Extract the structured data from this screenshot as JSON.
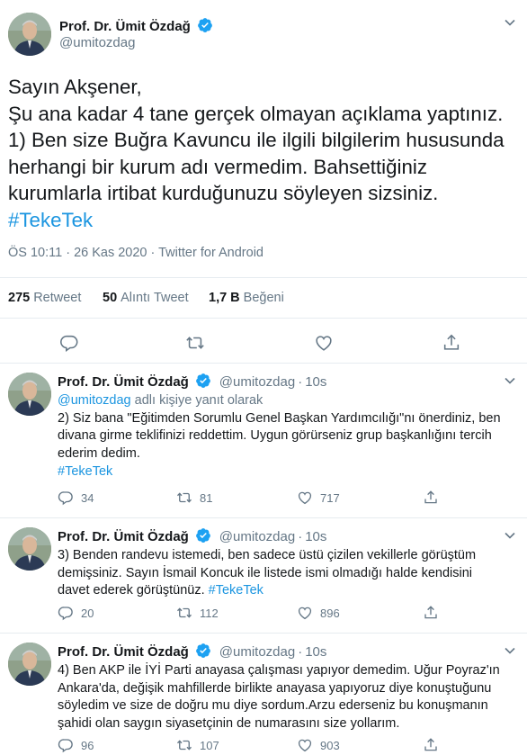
{
  "main_tweet": {
    "author_name": "Prof. Dr. Ümit Özdağ",
    "author_handle": "@umitozdag",
    "text_lines": [
      "Sayın Akşener,",
      "Şu ana kadar 4 tane gerçek olmayan açıklama yaptınız.",
      "1) Ben size Buğra Kavuncu ile ilgili bilgilerim hususunda",
      "herhangi bir kurum adı vermedim. Bahsettiğiniz",
      "kurumlarla irtibat kurduğunuzu söyleyen sizsiniz."
    ],
    "hashtag": "#TekeTek",
    "timestamp": "ÖS 10:11 · 26 Kas 2020 · Twitter for Android",
    "stats": {
      "retweets_count": "275",
      "retweets_label": "Retweet",
      "quotes_count": "50",
      "quotes_label": "Alıntı Tweet",
      "likes_count": "1,7 B",
      "likes_label": "Beğeni"
    }
  },
  "replies": [
    {
      "author_name": "Prof. Dr. Ümit Özdağ",
      "author_handle": "@umitozdag",
      "time": "10s",
      "reply_to_handle": "@umitozdag",
      "reply_to_text": "adlı kişiye yanıt olarak",
      "lines": [
        "2) Siz bana \"Eğitimden Sorumlu Genel Başkan Yardımcılığı\"nı önerdiniz, ben",
        "divana girme teklifinizi reddettim. Uygun görürseniz grup başkanlığını tercih",
        "ederim dedim."
      ],
      "hashtag": "#TekeTek",
      "reply_count": "34",
      "retweet_count": "81",
      "like_count": "717"
    },
    {
      "author_name": "Prof. Dr. Ümit Özdağ",
      "author_handle": "@umitozdag",
      "time": "10s",
      "lines": [
        "3) Benden randevu istemedi, ben sadece üstü çizilen vekillerle görüştüm",
        "demişsiniz. Sayın İsmail Koncuk ile listede ismi olmadığı halde kendisini",
        "davet ederek görüştünüz."
      ],
      "hashtag": "#TekeTek",
      "reply_count": "20",
      "retweet_count": "112",
      "like_count": "896"
    },
    {
      "author_name": "Prof. Dr. Ümit Özdağ",
      "author_handle": "@umitozdag",
      "time": "10s",
      "lines": [
        "4) Ben AKP ile İYİ Parti anayasa çalışması yapıyor demedim. Uğur Poyraz'ın",
        "Ankara'da, değişik mahfillerde birlikte anayasa yapıyoruz diye konuştuğunu",
        "söyledim ve size de doğru mu diye sordum.Arzu ederseniz bu konuşmanın",
        "şahidi olan saygın siyasetçinin de numarasını size yollarım."
      ],
      "reply_count": "96",
      "retweet_count": "107",
      "like_count": "903"
    }
  ],
  "icons": [
    "verified-badge-icon",
    "chevron-down-icon",
    "reply-icon",
    "retweet-icon",
    "like-icon",
    "share-icon"
  ],
  "colors": {
    "accent": "#1b95e0",
    "verified": "#1da1f2",
    "secondary_text": "#657786",
    "border": "#e6ecf0"
  }
}
